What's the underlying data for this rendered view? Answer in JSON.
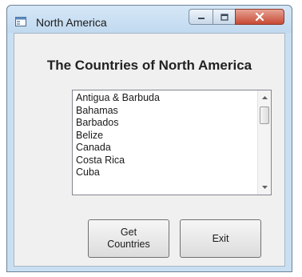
{
  "window": {
    "title": "North America"
  },
  "heading": "The Countries of North America",
  "countries": [
    "Antigua & Barbuda",
    "Bahamas",
    "Barbados",
    "Belize",
    "Canada",
    "Costa Rica",
    "Cuba"
  ],
  "buttons": {
    "get_countries_line1": "Get",
    "get_countries_line2": "Countries",
    "exit_label": "Exit"
  },
  "icons": {
    "app": "window-icon",
    "minimize": "minimize-icon",
    "maximize": "maximize-icon",
    "close": "close-icon",
    "scroll_up": "chevron-up-icon",
    "scroll_down": "chevron-down-icon"
  },
  "colors": {
    "title_bar": "#c9dff2",
    "close_button": "#c74a34",
    "client_background": "#f0f0f0"
  }
}
